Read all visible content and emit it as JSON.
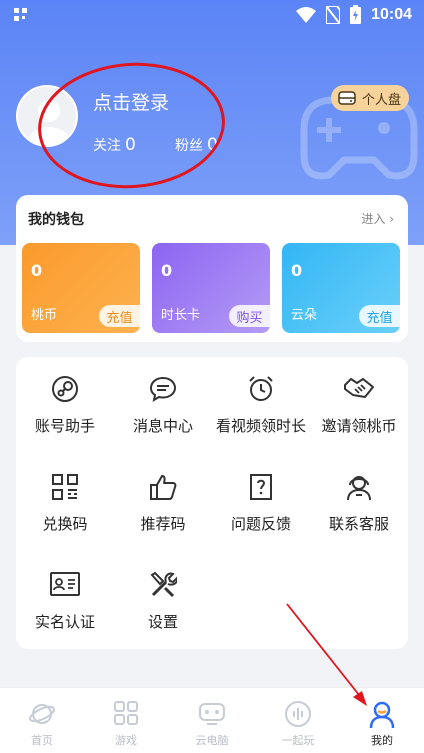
{
  "status_bar": {
    "time": "10:04"
  },
  "profile": {
    "login_text": "点击登录",
    "follow_label": "关注",
    "follow_count": "0",
    "fans_label": "粉丝",
    "fans_count": "0",
    "disk_button": "个人盘"
  },
  "wallet": {
    "title": "我的钱包",
    "enter": "进入 ›",
    "cards": [
      {
        "value": "0",
        "label": "桃币",
        "action": "充值"
      },
      {
        "value": "0",
        "label": "时长卡",
        "action": "购买"
      },
      {
        "value": "0",
        "label": "云朵",
        "action": "充值"
      }
    ]
  },
  "menu": {
    "items": [
      {
        "label": "账号助手",
        "icon": "steam-icon"
      },
      {
        "label": "消息中心",
        "icon": "message-icon"
      },
      {
        "label": "看视频领时长",
        "icon": "alarm-clock-icon"
      },
      {
        "label": "邀请领桃币",
        "icon": "handshake-icon"
      },
      {
        "label": "兑换码",
        "icon": "qr-code-icon"
      },
      {
        "label": "推荐码",
        "icon": "thumbs-up-icon"
      },
      {
        "label": "问题反馈",
        "icon": "feedback-icon"
      },
      {
        "label": "联系客服",
        "icon": "customer-service-icon"
      },
      {
        "label": "实名认证",
        "icon": "id-card-icon"
      },
      {
        "label": "设置",
        "icon": "tools-icon"
      }
    ]
  },
  "tabbar": {
    "tabs": [
      {
        "label": "首页",
        "icon": "planet-icon"
      },
      {
        "label": "游戏",
        "icon": "grid-icon"
      },
      {
        "label": "云电脑",
        "icon": "robot-icon"
      },
      {
        "label": "一起玩",
        "icon": "audio-icon"
      },
      {
        "label": "我的",
        "icon": "user-icon"
      }
    ],
    "active_index": 4
  },
  "colors": {
    "hero": "#5b84f6",
    "annotation": "#e0151d",
    "active_tab": "#2f6cf6"
  }
}
